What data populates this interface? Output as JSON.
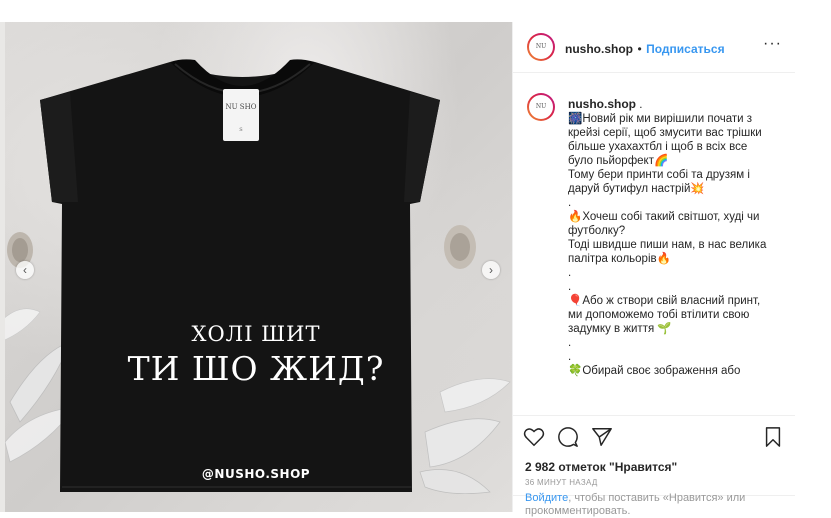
{
  "post": {
    "tag_brand": "NU SHO",
    "tag_size": "S",
    "print_line1": "ХОЛІ ШИТ",
    "print_line2": "ТИ ШО ЖИД?",
    "print_handle": "@NUSHO.SHOP",
    "prev_icon": "chevron-left-icon",
    "next_icon": "chevron-right-icon",
    "carousel_total": 9,
    "carousel_active_index": 5
  },
  "header": {
    "avatar_text": "NU SHO",
    "username": "nusho.shop",
    "separator": "•",
    "follow_label": "Подписаться",
    "more_label": "···"
  },
  "caption": {
    "avatar_text": "NU SHO",
    "username": "nusho.shop",
    "username_suffix": " .",
    "lines": [
      "🎆Новий рік ми вирішили почати з",
      "крейзі серії, щоб змусити вас трішки",
      "більше ухахахтбл і щоб в всіх все",
      "було пьйорфект🌈",
      "Тому бери принти собі та друзям і",
      "даруй бутифул настрій💥",
      ".",
      "🔥Хочеш собі такий світшот, худі чи",
      "футболку?",
      "Тоді швидше пиши нам, в нас велика",
      "палітра кольорів🔥",
      ".",
      ".",
      "🎈Або ж створи свій власний принт,",
      "ми допоможемо тобі втілити свою",
      "задумку в життя 🌱",
      ".",
      ".",
      "🍀Обирай своє зображення або"
    ]
  },
  "actions": {
    "like_icon": "heart-icon",
    "comment_icon": "comment-icon",
    "share_icon": "share-icon",
    "save_icon": "bookmark-icon",
    "likes_text": "2 982 отметок \"Нравится\"",
    "time_text": "36 МИНУТ НАЗАД",
    "login_link": "Войдите",
    "login_rest": ", чтобы поставить «Нравится» или прокомментировать."
  },
  "colors": {
    "accent": "#3897f0",
    "shirt": "#121212",
    "text": "#262626",
    "muted": "#999999"
  }
}
